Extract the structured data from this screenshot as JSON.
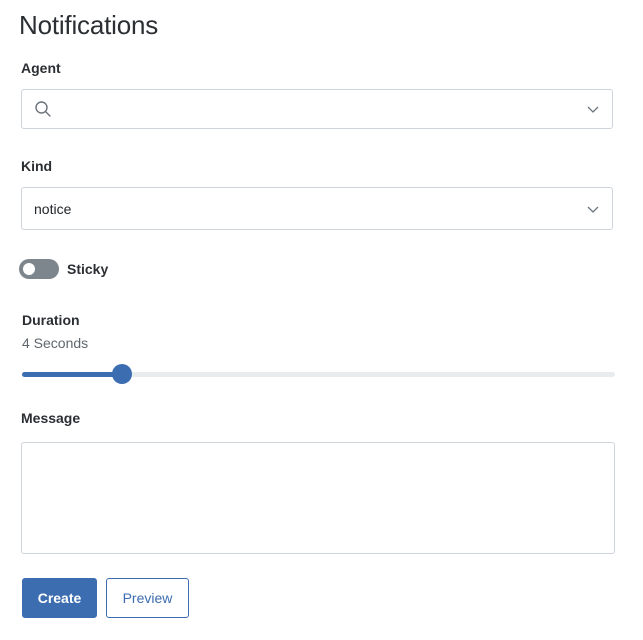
{
  "page": {
    "title": "Notifications"
  },
  "agent": {
    "label": "Agent",
    "value": "",
    "search_icon": "search-icon",
    "chevron_icon": "chevron-down-icon"
  },
  "kind": {
    "label": "Kind",
    "value": "notice",
    "chevron_icon": "chevron-down-icon"
  },
  "sticky": {
    "label": "Sticky",
    "checked": false
  },
  "duration": {
    "label": "Duration",
    "value_text": "4 Seconds",
    "fraction": 0.169
  },
  "message": {
    "label": "Message",
    "value": ""
  },
  "actions": {
    "create_label": "Create",
    "preview_label": "Preview"
  },
  "colors": {
    "primary": "#3c6db0",
    "toggle_off": "#7d858d",
    "border": "#ced4da"
  }
}
